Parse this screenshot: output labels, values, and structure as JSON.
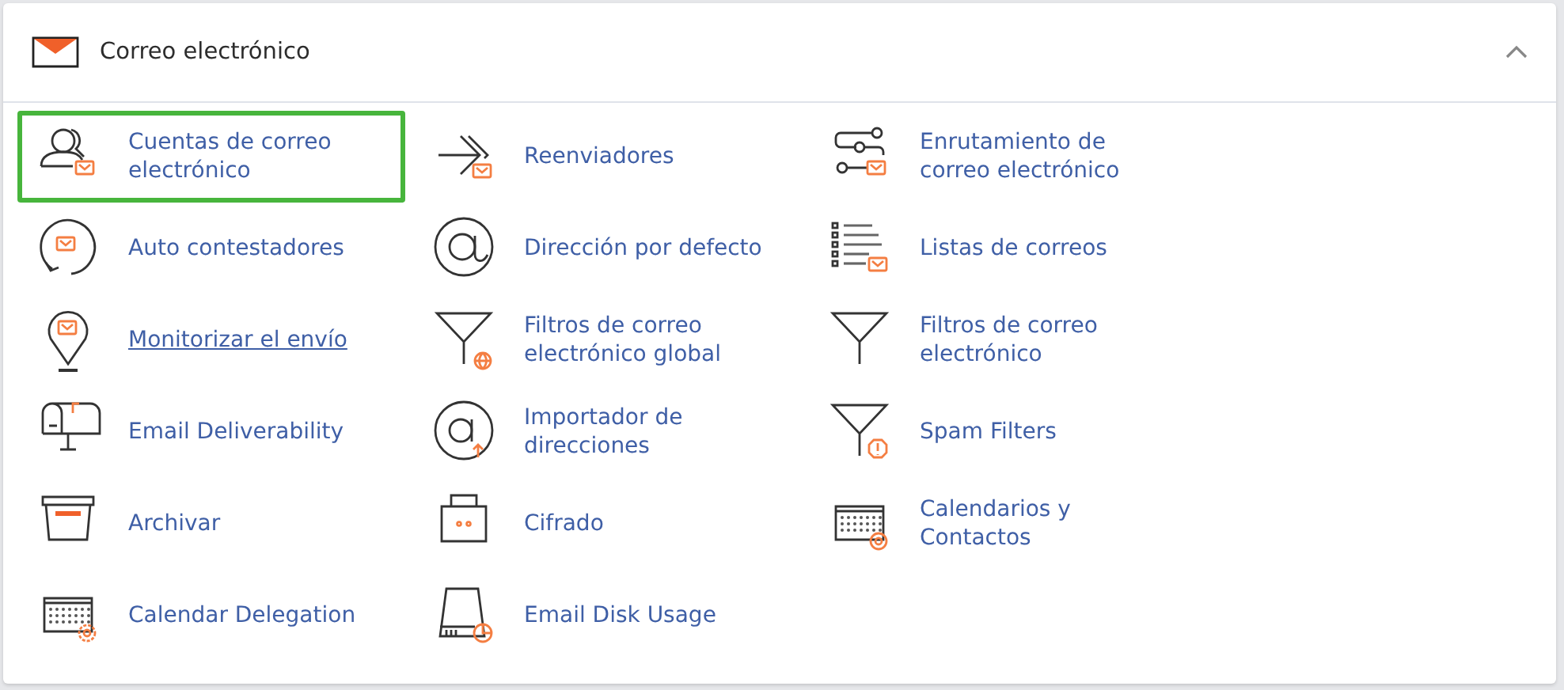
{
  "section": {
    "title": "Correo electrónico",
    "expanded": true
  },
  "items": [
    {
      "label": "Cuentas de correo electrónico",
      "kind": "user-mail",
      "highlighted": true,
      "underlined": false
    },
    {
      "label": "Reenviadores",
      "kind": "forward",
      "highlighted": false,
      "underlined": false
    },
    {
      "label": "Enrutamiento de correo electrónico",
      "kind": "route",
      "highlighted": false,
      "underlined": false
    },
    {
      "label": "Auto contestadores",
      "kind": "autoreply",
      "highlighted": false,
      "underlined": false
    },
    {
      "label": "Dirección por defecto",
      "kind": "at",
      "highlighted": false,
      "underlined": false
    },
    {
      "label": "Listas de correos",
      "kind": "list",
      "highlighted": false,
      "underlined": false
    },
    {
      "label": "Monitorizar el envío",
      "kind": "pin",
      "highlighted": false,
      "underlined": true
    },
    {
      "label": "Filtros de correo electrónico global",
      "kind": "filter-globe",
      "highlighted": false,
      "underlined": false
    },
    {
      "label": "Filtros de correo electrónico",
      "kind": "filter",
      "highlighted": false,
      "underlined": false
    },
    {
      "label": "Email Deliverability",
      "kind": "mailbox",
      "highlighted": false,
      "underlined": false
    },
    {
      "label": "Importador de direcciones",
      "kind": "at-import",
      "highlighted": false,
      "underlined": false
    },
    {
      "label": "Spam Filters",
      "kind": "filter-alert",
      "highlighted": false,
      "underlined": false
    },
    {
      "label": "Archivar",
      "kind": "archive",
      "highlighted": false,
      "underlined": false
    },
    {
      "label": "Cifrado",
      "kind": "lock",
      "highlighted": false,
      "underlined": false
    },
    {
      "label": "Calendarios y Contactos",
      "kind": "calendar-at",
      "highlighted": false,
      "underlined": false
    },
    {
      "label": "Calendar Delegation",
      "kind": "calendar-gear",
      "highlighted": false,
      "underlined": false
    },
    {
      "label": "Email Disk Usage",
      "kind": "disk",
      "highlighted": false,
      "underlined": false
    }
  ]
}
